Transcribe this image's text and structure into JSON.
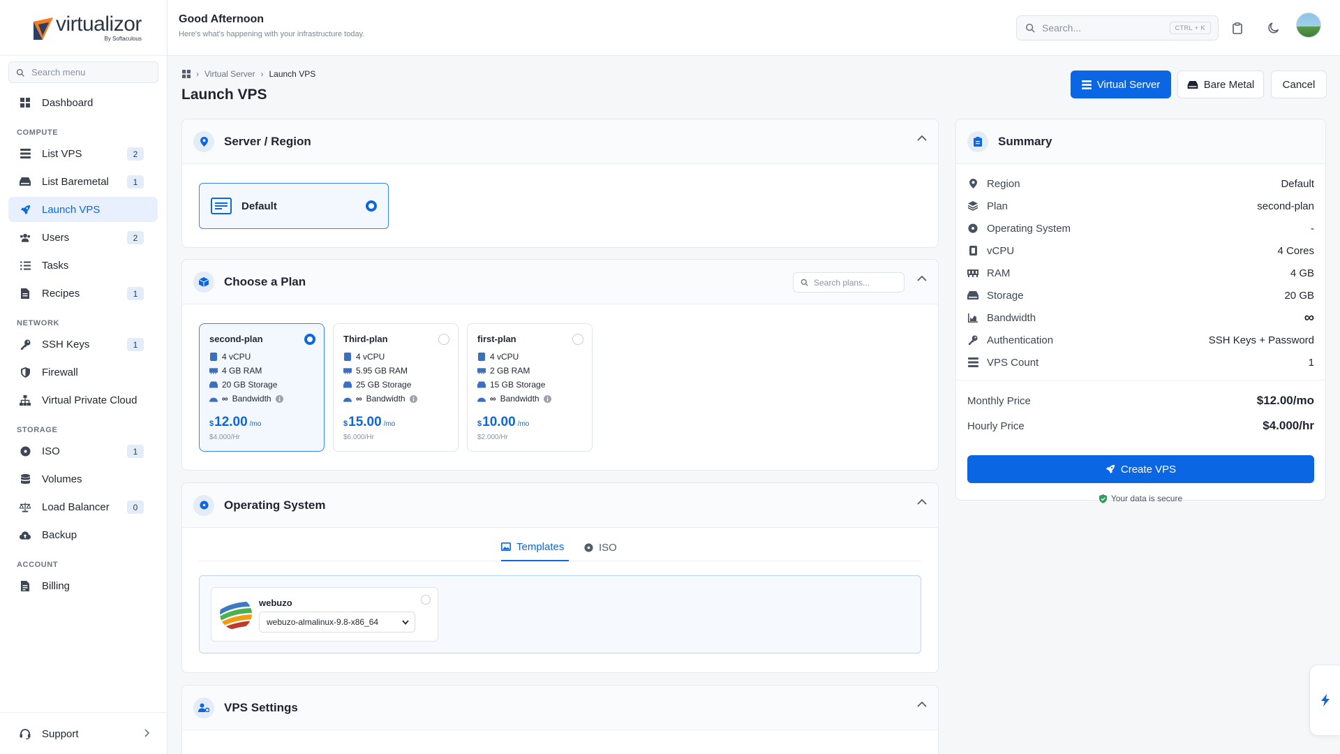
{
  "sidebar": {
    "brand_name": "virtualizor",
    "brand_by": "By Softaculous",
    "search_placeholder": "Search menu",
    "sections": {
      "compute": "COMPUTE",
      "network": "NETWORK",
      "storage": "STORAGE",
      "account": "ACCOUNT"
    },
    "items": {
      "dashboard": {
        "label": "Dashboard",
        "icon": "grid-icon"
      },
      "list_vps": {
        "label": "List VPS",
        "badge": "2",
        "icon": "server-icon"
      },
      "list_baremetal": {
        "label": "List Baremetal",
        "badge": "1",
        "icon": "hard-drive-icon"
      },
      "launch_vps": {
        "label": "Launch VPS",
        "icon": "rocket-icon"
      },
      "users": {
        "label": "Users",
        "badge": "2",
        "icon": "users-icon"
      },
      "tasks": {
        "label": "Tasks",
        "icon": "list-check-icon"
      },
      "recipes": {
        "label": "Recipes",
        "badge": "1",
        "icon": "file-icon"
      },
      "ssh_keys": {
        "label": "SSH Keys",
        "badge": "1",
        "icon": "key-icon"
      },
      "firewall": {
        "label": "Firewall",
        "icon": "shield-icon"
      },
      "vpc": {
        "label": "Virtual Private Cloud",
        "icon": "network-icon"
      },
      "iso": {
        "label": "ISO",
        "badge": "1",
        "icon": "disc-icon"
      },
      "volumes": {
        "label": "Volumes",
        "icon": "database-icon"
      },
      "load_balancer": {
        "label": "Load Balancer",
        "badge": "0",
        "icon": "scale-icon"
      },
      "backup": {
        "label": "Backup",
        "icon": "cloud-upload-icon"
      },
      "billing": {
        "label": "Billing",
        "icon": "receipt-icon"
      }
    },
    "support_label": "Support"
  },
  "topbar": {
    "greeting": "Good Afternoon",
    "subtitle": "Here's what's happening with your infrastructure today.",
    "search_placeholder": "Search...",
    "shortcut": "CTRL + K"
  },
  "breadcrumb": {
    "level1": "Virtual Server",
    "level2": "Launch VPS"
  },
  "page_title": "Launch VPS",
  "header_buttons": {
    "virtual_server": "Virtual Server",
    "bare_metal": "Bare Metal",
    "cancel": "Cancel"
  },
  "server_region": {
    "title": "Server / Region",
    "option": "Default"
  },
  "choose_plan": {
    "title": "Choose a Plan",
    "search_placeholder": "Search plans...",
    "plans": [
      {
        "name": "second-plan",
        "vcpu": "4 vCPU",
        "ram": "4 GB RAM",
        "storage": "20 GB Storage",
        "bandwidth": "Bandwidth",
        "currency": "$",
        "price": "12.00",
        "per": "/mo",
        "hourly": "$4.000/Hr"
      },
      {
        "name": "Third-plan",
        "vcpu": "4 vCPU",
        "ram": "5.95 GB RAM",
        "storage": "25 GB Storage",
        "bandwidth": "Bandwidth",
        "currency": "$",
        "price": "15.00",
        "per": "/mo",
        "hourly": "$6.000/Hr"
      },
      {
        "name": "first-plan",
        "vcpu": "4 vCPU",
        "ram": "2 GB RAM",
        "storage": "15 GB Storage",
        "bandwidth": "Bandwidth",
        "currency": "$",
        "price": "10.00",
        "per": "/mo",
        "hourly": "$2.000/Hr"
      }
    ]
  },
  "operating_system": {
    "title": "Operating System",
    "tab_templates": "Templates",
    "tab_iso": "ISO",
    "os_name": "webuzo",
    "os_version": "webuzo-almalinux-9.8-x86_64"
  },
  "vps_settings": {
    "title": "VPS Settings"
  },
  "summary": {
    "title": "Summary",
    "rows": {
      "region": {
        "label": "Region",
        "value": "Default"
      },
      "plan": {
        "label": "Plan",
        "value": "second-plan"
      },
      "os": {
        "label": "Operating System",
        "value": "-"
      },
      "vcpu": {
        "label": "vCPU",
        "value": "4 Cores"
      },
      "ram": {
        "label": "RAM",
        "value": "4 GB"
      },
      "storage": {
        "label": "Storage",
        "value": "20 GB"
      },
      "bandwidth": {
        "label": "Bandwidth",
        "value": "∞"
      },
      "auth": {
        "label": "Authentication",
        "value": "SSH Keys + Password"
      },
      "count": {
        "label": "VPS Count",
        "value": "1"
      }
    },
    "monthly_label": "Monthly Price",
    "monthly_value": "$12.00/mo",
    "hourly_label": "Hourly Price",
    "hourly_value": "$4.000/hr",
    "create_button": "Create VPS",
    "secure_text": "Your data is secure"
  },
  "colors": {
    "accent": "#0b66e4",
    "active_bg": "#e8f0fd"
  }
}
